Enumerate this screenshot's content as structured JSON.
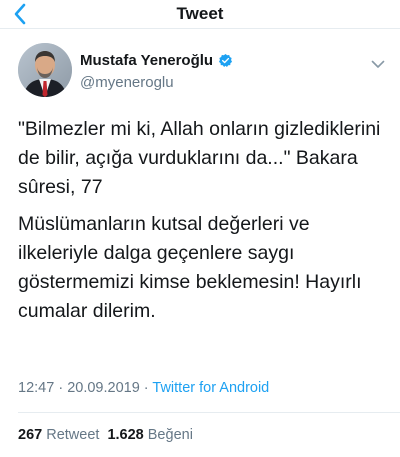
{
  "nav": {
    "title": "Tweet"
  },
  "author": {
    "name": "Mustafa Yeneroğlu",
    "handle": "@myeneroglu"
  },
  "tweet": {
    "paragraph1": "\"Bilmezler mi ki, Allah onların gizlediklerini de bilir, açığa vurduklarını da...\" Bakara sûresi, 77",
    "paragraph2": "Müslümanların kutsal değerleri ve ilkeleriyle dalga geçenlere saygı göstermemizi kimse beklemesin! Hayırlı cumalar dilerim."
  },
  "meta": {
    "time": "12:47",
    "separator1": " · ",
    "date": "20.09.2019",
    "separator2": " · ",
    "source": "Twitter for Android"
  },
  "stats": {
    "retweets_count": "267",
    "retweets_label": "Retweet",
    "likes_count": "1.628",
    "likes_label": "Beğeni"
  },
  "colors": {
    "accent": "#1da1f2",
    "secondary_text": "#657786",
    "primary_text": "#14171a"
  },
  "icons": {
    "back": "chevron-left-icon",
    "verified": "verified-badge-icon",
    "more": "chevron-down-icon"
  }
}
